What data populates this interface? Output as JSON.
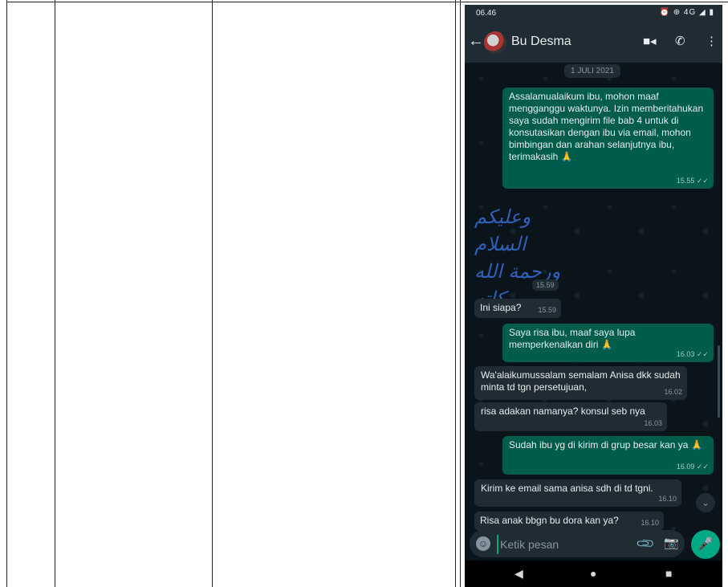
{
  "status": {
    "time": "06.46",
    "icons": "⏰ ⊕ 4G ◢ ▮"
  },
  "chat": {
    "contact_name": "Bu Desma",
    "date": "1 JULI 2021",
    "messages": [
      {
        "dir": "out",
        "text": "Assalamualaikum ibu, mohon maaf mengganggu waktunya. Izin memberitahukan saya sudah mengirim file bab 4 untuk di konsutasikan dengan ibu via email, mohon bimbingan dan arahan selanjutnya ibu, terimakasih 🙏",
        "time": "15.55 ✓✓"
      },
      {
        "dir": "in",
        "text": "Ini siapa?",
        "time": "15.59"
      },
      {
        "dir": "out",
        "text": "Saya risa ibu, maaf saya lupa memperkenalkan diri 🙏",
        "time": "16.03 ✓✓"
      },
      {
        "dir": "in",
        "text": "Wa'alaikumussalam semalam Anisa dkk sudah minta td tgn persetujuan,",
        "time": "16.02"
      },
      {
        "dir": "in",
        "text": "risa adakan namanya? konsul seb nya",
        "time": "16.03"
      },
      {
        "dir": "out",
        "text": "Sudah ibu yg di kirim di grup besar kan ya 🙏",
        "time": "16.09 ✓✓"
      },
      {
        "dir": "in",
        "text": "Kirim ke email sama anisa sdh di td tgni.",
        "time": "16.10"
      },
      {
        "dir": "in",
        "text": "Risa anak bbgn bu dora kan ya?",
        "time": "16.10"
      }
    ],
    "sticker": {
      "line1": "وعليكم السلام",
      "line2": "ورحمة الله وبركاته",
      "time": "15.59"
    }
  },
  "composer": {
    "placeholder": "Ketik pesan"
  },
  "colors": {
    "outgoing": "#005c4b",
    "incoming": "#1f2c34",
    "accent": "#00a884"
  }
}
